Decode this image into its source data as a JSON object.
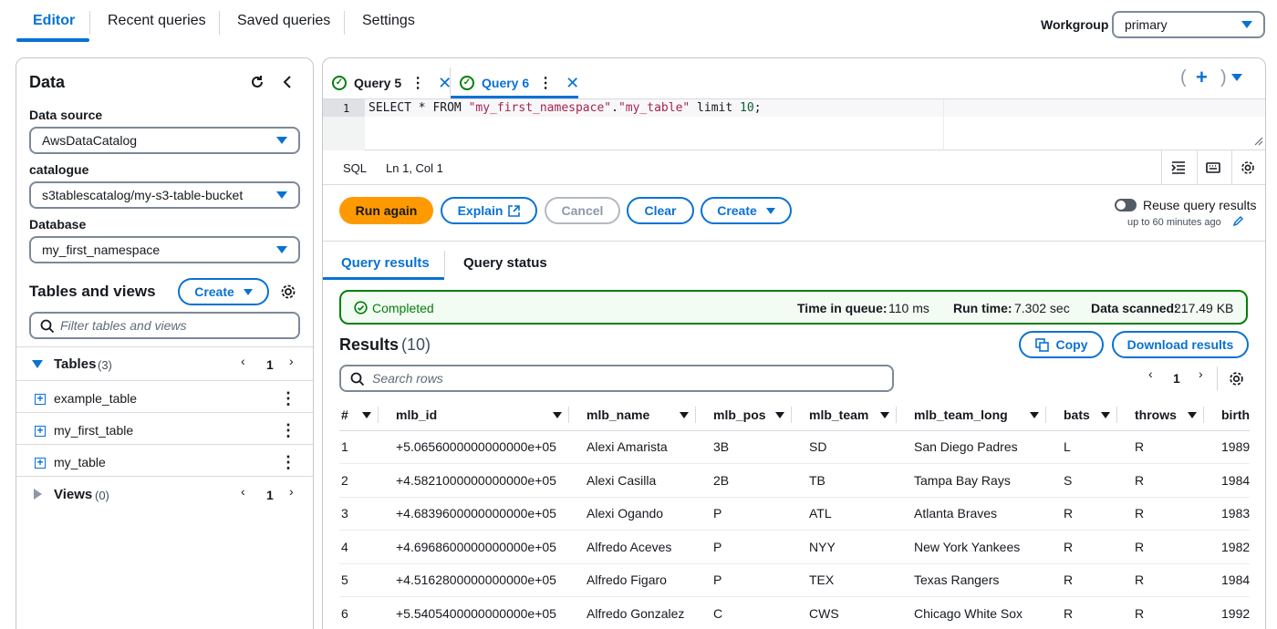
{
  "nav": {
    "tabs": [
      {
        "label": "Editor",
        "active": true
      },
      {
        "label": "Recent queries"
      },
      {
        "label": "Saved queries"
      },
      {
        "label": "Settings"
      }
    ],
    "workgroup_label": "Workgroup",
    "workgroup_value": "primary"
  },
  "left": {
    "title": "Data",
    "data_source_label": "Data source",
    "data_source_value": "AwsDataCatalog",
    "catalogue_label": "catalogue",
    "catalogue_value": "s3tablescatalog/my-s3-table-bucket",
    "database_label": "Database",
    "database_value": "my_first_namespace",
    "tables_views_title": "Tables and views",
    "create_label": "Create",
    "filter_placeholder": "Filter tables and views",
    "tables_label": "Tables",
    "tables_count": "(3)",
    "tables_page": "1",
    "tables": [
      "example_table",
      "my_first_table",
      "my_table"
    ],
    "views_label": "Views",
    "views_count": "(0)",
    "views_page": "1"
  },
  "editor": {
    "tabs": [
      {
        "label": "Query 5",
        "active": false
      },
      {
        "label": "Query 6",
        "active": true
      }
    ],
    "line_number": "1",
    "sql": {
      "kw1": "SELECT * FROM ",
      "str1": "\"my_first_namespace\"",
      "dot": ".",
      "str2": "\"my_table\"",
      "kw2": " limit ",
      "num": "10",
      "end": ";"
    },
    "language": "SQL",
    "cursor": "Ln 1, Col 1"
  },
  "actions": {
    "run": "Run again",
    "explain": "Explain",
    "cancel": "Cancel",
    "clear": "Clear",
    "create": "Create",
    "reuse_label": "Reuse query results",
    "reuse_sub": "up to 60 minutes ago"
  },
  "results": {
    "tabs": [
      "Query results",
      "Query status"
    ],
    "status": "Completed",
    "time_in_queue_label": "Time in queue:",
    "time_in_queue": "110 ms",
    "run_time_label": "Run time:",
    "run_time": "7.302 sec",
    "data_scanned_label": "Data scanned:",
    "data_scanned": "217.49 KB",
    "title": "Results",
    "count": "(10)",
    "copy": "Copy",
    "download": "Download results",
    "search_placeholder": "Search rows",
    "page": "1",
    "columns": [
      "#",
      "mlb_id",
      "mlb_name",
      "mlb_pos",
      "mlb_team",
      "mlb_team_long",
      "bats",
      "throws",
      "birth"
    ],
    "rows": [
      [
        "1",
        "+5.0656000000000000e+05",
        "Alexi Amarista",
        "3B",
        "SD",
        "San Diego Padres",
        "L",
        "R",
        "1989"
      ],
      [
        "2",
        "+4.5821000000000000e+05",
        "Alexi Casilla",
        "2B",
        "TB",
        "Tampa Bay Rays",
        "S",
        "R",
        "1984"
      ],
      [
        "3",
        "+4.6839600000000000e+05",
        "Alexi Ogando",
        "P",
        "ATL",
        "Atlanta Braves",
        "R",
        "R",
        "1983"
      ],
      [
        "4",
        "+4.6968600000000000e+05",
        "Alfredo Aceves",
        "P",
        "NYY",
        "New York Yankees",
        "R",
        "R",
        "1982"
      ],
      [
        "5",
        "+4.5162800000000000e+05",
        "Alfredo Figaro",
        "P",
        "TEX",
        "Texas Rangers",
        "R",
        "R",
        "1984"
      ],
      [
        "6",
        "+5.5405400000000000e+05",
        "Alfredo Gonzalez",
        "C",
        "CWS",
        "Chicago White Sox",
        "R",
        "R",
        "1992"
      ]
    ]
  }
}
